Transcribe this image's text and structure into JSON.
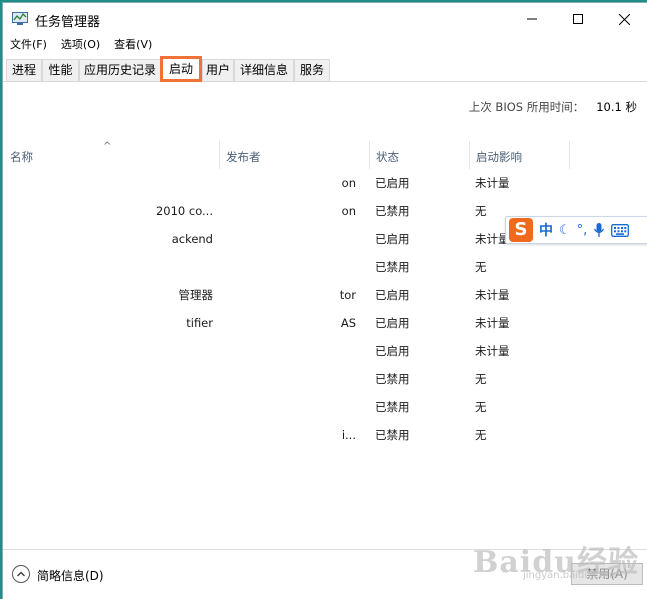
{
  "window": {
    "title": "任务管理器"
  },
  "menu": [
    "文件(F)",
    "选项(O)",
    "查看(V)"
  ],
  "tabs": [
    "进程",
    "性能",
    "应用历史记录",
    "启动",
    "用户",
    "详细信息",
    "服务"
  ],
  "active_tab": "启动",
  "bios": {
    "label": "上次 BIOS 所用时间：",
    "value": "10.1 秒"
  },
  "columns": {
    "name": "名称",
    "publisher": "发布者",
    "status": "状态",
    "impact": "启动影响"
  },
  "rows": [
    {
      "name": "",
      "publisher": "on",
      "status": "已启用",
      "impact": "未计量"
    },
    {
      "name": "2010 co...",
      "publisher": "on",
      "status": "已禁用",
      "impact": "无"
    },
    {
      "name": "ackend",
      "publisher": "",
      "status": "已启用",
      "impact": "未计量"
    },
    {
      "name": "",
      "publisher": "",
      "status": "已禁用",
      "impact": "无"
    },
    {
      "name": "管理器",
      "publisher": "tor",
      "status": "已启用",
      "impact": "未计量"
    },
    {
      "name": "tifier",
      "publisher": "AS",
      "status": "已启用",
      "impact": "未计量"
    },
    {
      "name": "",
      "publisher": "",
      "status": "已启用",
      "impact": "未计量"
    },
    {
      "name": "",
      "publisher": "",
      "status": "已禁用",
      "impact": "无"
    },
    {
      "name": "",
      "publisher": "",
      "status": "已禁用",
      "impact": "无"
    },
    {
      "name": "",
      "publisher": "i...",
      "status": "已禁用",
      "impact": "无"
    }
  ],
  "ime": {
    "lang": "中",
    "logo": "S"
  },
  "footer": {
    "fewer_details": "简略信息(D)",
    "disable_button": "禁用(A)"
  },
  "watermark": {
    "text": "Baidu经验",
    "url": "jingyan.baidu.com"
  },
  "colors": {
    "accent_highlight": "#ef7236",
    "desktop": "#1f8f86",
    "ime_logo": "#f06a1d"
  }
}
